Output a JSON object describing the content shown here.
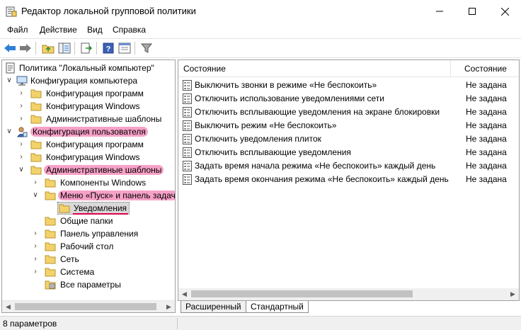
{
  "window": {
    "title": "Редактор локальной групповой политики"
  },
  "menu": [
    "Файл",
    "Действие",
    "Вид",
    "Справка"
  ],
  "toolbar": {
    "icons": [
      "back-arrow-icon",
      "forward-arrow-icon",
      "up-folder-icon",
      "show-hide-tree-icon",
      "export-list-icon",
      "help-icon",
      "properties-icon",
      "filter-icon"
    ]
  },
  "tree": {
    "root": "Политика \"Локальный компьютер\"",
    "computer_config": "Конфигурация компьютера",
    "computer_children": [
      "Конфигурация программ",
      "Конфигурация Windows",
      "Административные шаблоны"
    ],
    "user_config": "Конфигурация пользователя",
    "user_children": [
      "Конфигурация программ",
      "Конфигурация Windows"
    ],
    "admin_templates": "Административные шаблоны",
    "windows_components": "Компоненты Windows",
    "start_menu": "Меню «Пуск» и панель задач",
    "notifications": "Уведомления",
    "admin_rest": [
      "Общие папки",
      "Панель управления",
      "Рабочий стол",
      "Сеть",
      "Система",
      "Все параметры"
    ]
  },
  "list": {
    "columns": [
      "Состояние",
      "Состояние"
    ],
    "rows": [
      {
        "name": "Выключить звонки в режиме «Не беспокоить»",
        "state": "Не задана"
      },
      {
        "name": "Отключить использование уведомлениями сети",
        "state": "Не задана"
      },
      {
        "name": "Отключить всплывающие уведомления на экране блокировки",
        "state": "Не задана"
      },
      {
        "name": "Выключить режим «Не беспокоить»",
        "state": "Не задана"
      },
      {
        "name": "Отключить уведомления плиток",
        "state": "Не задана"
      },
      {
        "name": "Отключить всплывающие уведомления",
        "state": "Не задана"
      },
      {
        "name": "Задать время начала режима «Не беспокоить» каждый день",
        "state": "Не задана"
      },
      {
        "name": "Задать время окончания режима «Не беспокоить» каждый день",
        "state": "Не задана"
      }
    ]
  },
  "tabs": [
    "Расширенный",
    "Стандартный"
  ],
  "status": {
    "text": "8 параметров"
  },
  "colors": {
    "highlight": "#f7a1c8",
    "underline": "#e0004d",
    "folder": "#f4d26b"
  }
}
